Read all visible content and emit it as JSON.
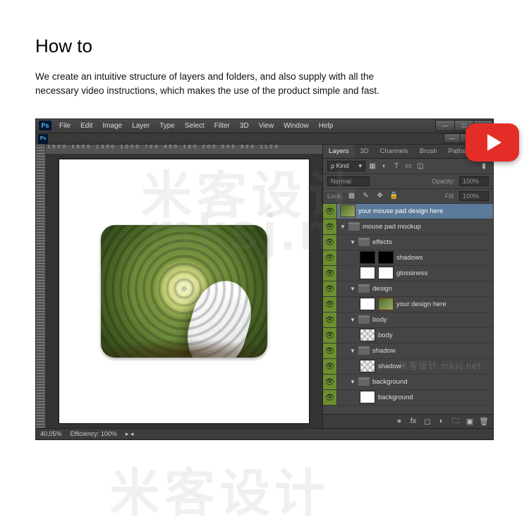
{
  "page": {
    "title": "How to",
    "description": "We create an intuitive structure of layers and folders, and also supply with all the necessary video instructions, which makes the use of the product simple and fast."
  },
  "menu": {
    "items": [
      "File",
      "Edit",
      "Image",
      "Layer",
      "Type",
      "Select",
      "Filter",
      "3D",
      "View",
      "Window",
      "Help"
    ]
  },
  "ruler": {
    "marks": "1900   1600   1300   1000   700   400   100   200   500   800   1100"
  },
  "panels": {
    "tabs": [
      "Layers",
      "3D",
      "Channels",
      "Brush",
      "Paths"
    ],
    "filterLabel": "ρ Kind",
    "blendMode": "Normal",
    "opacityLabel": "Opacity:",
    "opacityValue": "100%",
    "lockLabel": "Lock:",
    "fillLabel": "Fill:",
    "fillValue": "100%"
  },
  "layers": [
    {
      "indent": 0,
      "type": "smart",
      "name": "your mouse pad design here",
      "selected": true,
      "chev": ""
    },
    {
      "indent": 0,
      "type": "folder",
      "name": "mouse pad mockup",
      "chev": "▼"
    },
    {
      "indent": 1,
      "type": "folder",
      "name": "effects",
      "chev": "▼"
    },
    {
      "indent": 2,
      "type": "mask",
      "thumb": "black",
      "name": "shadows",
      "chev": ""
    },
    {
      "indent": 2,
      "type": "mask",
      "thumb": "white",
      "name": "glossiness",
      "chev": ""
    },
    {
      "indent": 1,
      "type": "folder",
      "name": "design",
      "chev": "▼"
    },
    {
      "indent": 2,
      "type": "smart",
      "name": "your design here",
      "chev": "",
      "hasMask": true
    },
    {
      "indent": 1,
      "type": "folder",
      "name": "body",
      "chev": "▼"
    },
    {
      "indent": 2,
      "type": "checker",
      "name": "body",
      "chev": ""
    },
    {
      "indent": 1,
      "type": "folder",
      "name": "shadow",
      "chev": "▼"
    },
    {
      "indent": 2,
      "type": "checker",
      "name": "shadow",
      "chev": ""
    },
    {
      "indent": 1,
      "type": "folder",
      "name": "background",
      "chev": "▼"
    },
    {
      "indent": 2,
      "type": "white",
      "name": "background",
      "chev": ""
    }
  ],
  "status": {
    "zoom": "40,05%",
    "efficiency": "Efficiency: 100%"
  },
  "watermark": {
    "cn": "米客设计",
    "en": "mksj.n",
    "tag": "米客设计 mksj.net"
  }
}
